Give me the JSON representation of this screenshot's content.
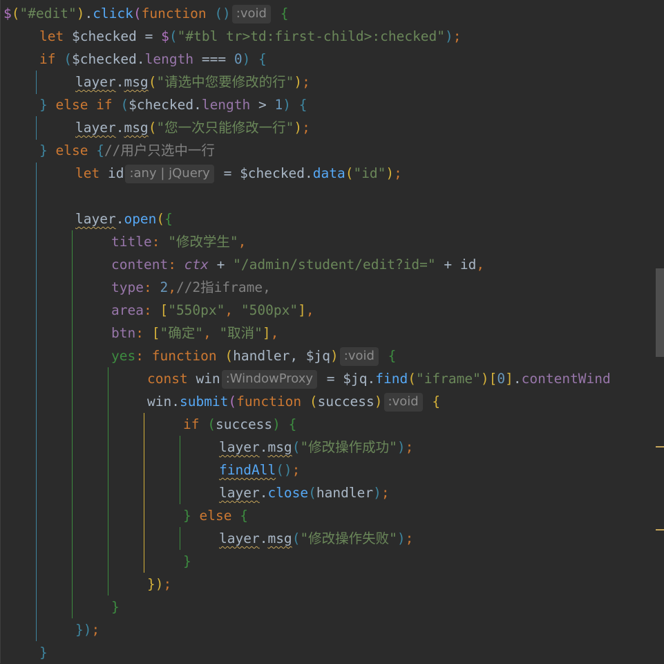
{
  "colors": {
    "background": "#2b2b2b",
    "text": "#a9b7c6",
    "keyword": "#cc7832",
    "string": "#6a8759",
    "number": "#6897bb",
    "function": "#56a8f5",
    "property": "#9876aa",
    "comment": "#808080",
    "hint_bg": "#3b3b3b",
    "hint_fg": "#8c8c8c",
    "brace_green": "#3d8c40",
    "brace_blue": "#3e86a0",
    "brace_yellow": "#d6b23a",
    "brace_purple": "#b074c0"
  },
  "code_lines": [
    {
      "indent": 0,
      "segments": [
        {
          "t": "$",
          "c": "#b074c0"
        },
        {
          "t": "(",
          "c": "#d6b23a"
        },
        {
          "t": "\"#edit\"",
          "c": "#6a8759"
        },
        {
          "t": ")",
          "c": "#d6b23a"
        },
        {
          "t": ".",
          "c": "#a9b7c6"
        },
        {
          "t": "click",
          "c": "#56a8f5"
        },
        {
          "t": "(",
          "c": "#b074c0"
        },
        {
          "t": "function ",
          "c": "#cc7832"
        },
        {
          "t": "()",
          "c": "#3e86a0"
        },
        {
          "t": ":void",
          "hint": true
        },
        {
          "t": " {",
          "c": "#3d8c40"
        }
      ]
    },
    {
      "indent": 1,
      "segments": [
        {
          "t": "let ",
          "c": "#cc7832"
        },
        {
          "t": "$checked = ",
          "c": "#a9b7c6"
        },
        {
          "t": "$",
          "c": "#b074c0"
        },
        {
          "t": "(",
          "c": "#3e86a0"
        },
        {
          "t": "\"#tbl tr>td:first-child>:checked\"",
          "c": "#6a8759"
        },
        {
          "t": ")",
          "c": "#3e86a0"
        },
        {
          "t": ";",
          "c": "#cc7832"
        }
      ]
    },
    {
      "indent": 1,
      "segments": [
        {
          "t": "if ",
          "c": "#cc7832"
        },
        {
          "t": "(",
          "c": "#3e86a0"
        },
        {
          "t": "$checked.",
          "c": "#a9b7c6"
        },
        {
          "t": "length",
          "c": "#9876aa"
        },
        {
          "t": " === ",
          "c": "#a9b7c6"
        },
        {
          "t": "0",
          "c": "#6897bb"
        },
        {
          "t": ") ",
          "c": "#3e86a0"
        },
        {
          "t": "{",
          "c": "#3e86a0"
        }
      ]
    },
    {
      "indent": 2,
      "segments": [
        {
          "t": "layer",
          "c": "#a9b7c6",
          "sq": true
        },
        {
          "t": ".",
          "c": "#a9b7c6"
        },
        {
          "t": "msg",
          "c": "#a9b7c6",
          "sq": true
        },
        {
          "t": "(",
          "c": "#d6b23a"
        },
        {
          "t": "\"请选中您要修改的行\"",
          "c": "#6a8759"
        },
        {
          "t": ")",
          "c": "#d6b23a"
        },
        {
          "t": ";",
          "c": "#cc7832"
        }
      ]
    },
    {
      "indent": 1,
      "segments": [
        {
          "t": "} ",
          "c": "#3e86a0"
        },
        {
          "t": "else if ",
          "c": "#cc7832"
        },
        {
          "t": "(",
          "c": "#3e86a0"
        },
        {
          "t": "$checked.",
          "c": "#a9b7c6"
        },
        {
          "t": "length",
          "c": "#9876aa"
        },
        {
          "t": " > ",
          "c": "#a9b7c6"
        },
        {
          "t": "1",
          "c": "#6897bb"
        },
        {
          "t": ") ",
          "c": "#3e86a0"
        },
        {
          "t": "{",
          "c": "#3e86a0"
        }
      ]
    },
    {
      "indent": 2,
      "segments": [
        {
          "t": "layer",
          "c": "#a9b7c6",
          "sq": true
        },
        {
          "t": ".",
          "c": "#a9b7c6"
        },
        {
          "t": "msg",
          "c": "#a9b7c6",
          "sq": true
        },
        {
          "t": "(",
          "c": "#d6b23a"
        },
        {
          "t": "\"您一次只能修改一行\"",
          "c": "#6a8759"
        },
        {
          "t": ")",
          "c": "#d6b23a"
        },
        {
          "t": ";",
          "c": "#cc7832"
        }
      ]
    },
    {
      "indent": 1,
      "segments": [
        {
          "t": "} ",
          "c": "#3e86a0"
        },
        {
          "t": "else ",
          "c": "#cc7832"
        },
        {
          "t": "{",
          "c": "#3e86a0"
        },
        {
          "t": "//用户只选中一行",
          "c": "#808080"
        }
      ]
    },
    {
      "indent": 2,
      "segments": [
        {
          "t": "let ",
          "c": "#cc7832"
        },
        {
          "t": "id",
          "c": "#a9b7c6"
        },
        {
          "t": ":any | jQuery",
          "hint": true
        },
        {
          "t": " = ",
          "c": "#a9b7c6"
        },
        {
          "t": "$checked.",
          "c": "#a9b7c6"
        },
        {
          "t": "data",
          "c": "#56a8f5"
        },
        {
          "t": "(",
          "c": "#d6b23a"
        },
        {
          "t": "\"id\"",
          "c": "#6a8759"
        },
        {
          "t": ")",
          "c": "#d6b23a"
        },
        {
          "t": ";",
          "c": "#cc7832"
        }
      ]
    },
    {
      "indent": 0,
      "segments": []
    },
    {
      "indent": 2,
      "segments": [
        {
          "t": "layer",
          "c": "#a9b7c6",
          "sq": true
        },
        {
          "t": ".",
          "c": "#a9b7c6"
        },
        {
          "t": "open",
          "c": "#56a8f5"
        },
        {
          "t": "(",
          "c": "#d6b23a"
        },
        {
          "t": "{",
          "c": "#3d8c40"
        }
      ]
    },
    {
      "indent": 3,
      "segments": [
        {
          "t": "title",
          "c": "#9876aa"
        },
        {
          "t": ": ",
          "c": "#cc7832"
        },
        {
          "t": "\"修改学生\"",
          "c": "#6a8759"
        },
        {
          "t": ",",
          "c": "#cc7832"
        }
      ]
    },
    {
      "indent": 3,
      "segments": [
        {
          "t": "content",
          "c": "#9876aa"
        },
        {
          "t": ": ",
          "c": "#cc7832"
        },
        {
          "t": "ctx",
          "c": "#9876aa",
          "it": true
        },
        {
          "t": " + ",
          "c": "#a9b7c6"
        },
        {
          "t": "\"/admin/student/edit?id=\"",
          "c": "#6a8759"
        },
        {
          "t": " + ",
          "c": "#a9b7c6"
        },
        {
          "t": "id",
          "c": "#a9b7c6"
        },
        {
          "t": ",",
          "c": "#cc7832"
        }
      ]
    },
    {
      "indent": 3,
      "segments": [
        {
          "t": "type",
          "c": "#9876aa"
        },
        {
          "t": ": ",
          "c": "#cc7832"
        },
        {
          "t": "2",
          "c": "#6897bb"
        },
        {
          "t": ",",
          "c": "#cc7832"
        },
        {
          "t": "//2指iframe,",
          "c": "#808080"
        }
      ]
    },
    {
      "indent": 3,
      "segments": [
        {
          "t": "area",
          "c": "#9876aa"
        },
        {
          "t": ": ",
          "c": "#cc7832"
        },
        {
          "t": "[",
          "c": "#d6b23a"
        },
        {
          "t": "\"550px\"",
          "c": "#6a8759"
        },
        {
          "t": ", ",
          "c": "#cc7832"
        },
        {
          "t": "\"500px\"",
          "c": "#6a8759"
        },
        {
          "t": "]",
          "c": "#d6b23a"
        },
        {
          "t": ",",
          "c": "#cc7832"
        }
      ]
    },
    {
      "indent": 3,
      "segments": [
        {
          "t": "btn",
          "c": "#9876aa"
        },
        {
          "t": ": ",
          "c": "#cc7832"
        },
        {
          "t": "[",
          "c": "#d6b23a"
        },
        {
          "t": "\"确定\"",
          "c": "#6a8759"
        },
        {
          "t": ", ",
          "c": "#cc7832"
        },
        {
          "t": "\"取消\"",
          "c": "#6a8759"
        },
        {
          "t": "]",
          "c": "#d6b23a"
        },
        {
          "t": ",",
          "c": "#cc7832"
        }
      ]
    },
    {
      "indent": 3,
      "segments": [
        {
          "t": "yes",
          "c": "#3d8c40"
        },
        {
          "t": ": ",
          "c": "#cc7832"
        },
        {
          "t": "function ",
          "c": "#cc7832"
        },
        {
          "t": "(",
          "c": "#d6b23a"
        },
        {
          "t": "handler, $jq",
          "c": "#a9b7c6"
        },
        {
          "t": ")",
          "c": "#d6b23a"
        },
        {
          "t": ":void",
          "hint": true
        },
        {
          "t": " {",
          "c": "#3d8c40"
        }
      ]
    },
    {
      "indent": 4,
      "segments": [
        {
          "t": "const ",
          "c": "#cc7832"
        },
        {
          "t": "win",
          "c": "#a9b7c6"
        },
        {
          "t": ":WindowProxy",
          "hint": true
        },
        {
          "t": " = ",
          "c": "#a9b7c6"
        },
        {
          "t": "$jq.",
          "c": "#a9b7c6"
        },
        {
          "t": "find",
          "c": "#56a8f5"
        },
        {
          "t": "(",
          "c": "#d6b23a"
        },
        {
          "t": "\"iframe\"",
          "c": "#6a8759"
        },
        {
          "t": ")",
          "c": "#d6b23a"
        },
        {
          "t": "[",
          "c": "#d6b23a"
        },
        {
          "t": "0",
          "c": "#6897bb"
        },
        {
          "t": "]",
          "c": "#d6b23a"
        },
        {
          "t": ".",
          "c": "#a9b7c6"
        },
        {
          "t": "contentWind",
          "c": "#9876aa"
        }
      ]
    },
    {
      "indent": 4,
      "segments": [
        {
          "t": "win.",
          "c": "#a9b7c6"
        },
        {
          "t": "submit",
          "c": "#56a8f5"
        },
        {
          "t": "(",
          "c": "#b074c0"
        },
        {
          "t": "function ",
          "c": "#cc7832"
        },
        {
          "t": "(",
          "c": "#d6b23a"
        },
        {
          "t": "success",
          "c": "#a9b7c6"
        },
        {
          "t": ")",
          "c": "#d6b23a"
        },
        {
          "t": ":void",
          "hint": true
        },
        {
          "t": " {",
          "c": "#d6b23a"
        }
      ]
    },
    {
      "indent": 5,
      "segments": [
        {
          "t": "if ",
          "c": "#cc7832"
        },
        {
          "t": "(",
          "c": "#3d8c40"
        },
        {
          "t": "success",
          "c": "#a9b7c6"
        },
        {
          "t": ") ",
          "c": "#3d8c40"
        },
        {
          "t": "{",
          "c": "#3d8c40"
        }
      ]
    },
    {
      "indent": 6,
      "segments": [
        {
          "t": "layer",
          "c": "#a9b7c6",
          "sq": true
        },
        {
          "t": ".",
          "c": "#a9b7c6"
        },
        {
          "t": "msg",
          "c": "#a9b7c6",
          "sq": true
        },
        {
          "t": "(",
          "c": "#3e86a0"
        },
        {
          "t": "\"修改操作成功\"",
          "c": "#6a8759"
        },
        {
          "t": ")",
          "c": "#3e86a0"
        },
        {
          "t": ";",
          "c": "#cc7832"
        }
      ]
    },
    {
      "indent": 6,
      "segments": [
        {
          "t": "findAll",
          "c": "#56a8f5",
          "sq": true
        },
        {
          "t": "()",
          "c": "#3e86a0"
        },
        {
          "t": ";",
          "c": "#cc7832"
        }
      ]
    },
    {
      "indent": 6,
      "segments": [
        {
          "t": "layer",
          "c": "#a9b7c6",
          "sq": true
        },
        {
          "t": ".",
          "c": "#a9b7c6"
        },
        {
          "t": "close",
          "c": "#56a8f5"
        },
        {
          "t": "(",
          "c": "#3e86a0"
        },
        {
          "t": "handler",
          "c": "#a9b7c6"
        },
        {
          "t": ")",
          "c": "#3e86a0"
        },
        {
          "t": ";",
          "c": "#cc7832"
        }
      ]
    },
    {
      "indent": 5,
      "segments": [
        {
          "t": "} ",
          "c": "#3d8c40"
        },
        {
          "t": "else ",
          "c": "#cc7832"
        },
        {
          "t": "{",
          "c": "#3d8c40"
        }
      ]
    },
    {
      "indent": 6,
      "segments": [
        {
          "t": "layer",
          "c": "#a9b7c6",
          "sq": true
        },
        {
          "t": ".",
          "c": "#a9b7c6"
        },
        {
          "t": "msg",
          "c": "#a9b7c6",
          "sq": true
        },
        {
          "t": "(",
          "c": "#3e86a0"
        },
        {
          "t": "\"修改操作失败\"",
          "c": "#6a8759"
        },
        {
          "t": ")",
          "c": "#3e86a0"
        },
        {
          "t": ";",
          "c": "#cc7832"
        }
      ]
    },
    {
      "indent": 5,
      "segments": [
        {
          "t": "}",
          "c": "#3d8c40"
        }
      ]
    },
    {
      "indent": 4,
      "segments": [
        {
          "t": "})",
          "c": "#d6b23a"
        },
        {
          "t": ";",
          "c": "#cc7832"
        }
      ]
    },
    {
      "indent": 3,
      "segments": [
        {
          "t": "}",
          "c": "#3d8c40"
        }
      ]
    },
    {
      "indent": 2,
      "segments": [
        {
          "t": "})",
          "c": "#3e86a0"
        },
        {
          "t": ";",
          "c": "#cc7832"
        }
      ]
    },
    {
      "indent": 1,
      "segments": [
        {
          "t": "}",
          "c": "#3e86a0"
        }
      ]
    }
  ]
}
